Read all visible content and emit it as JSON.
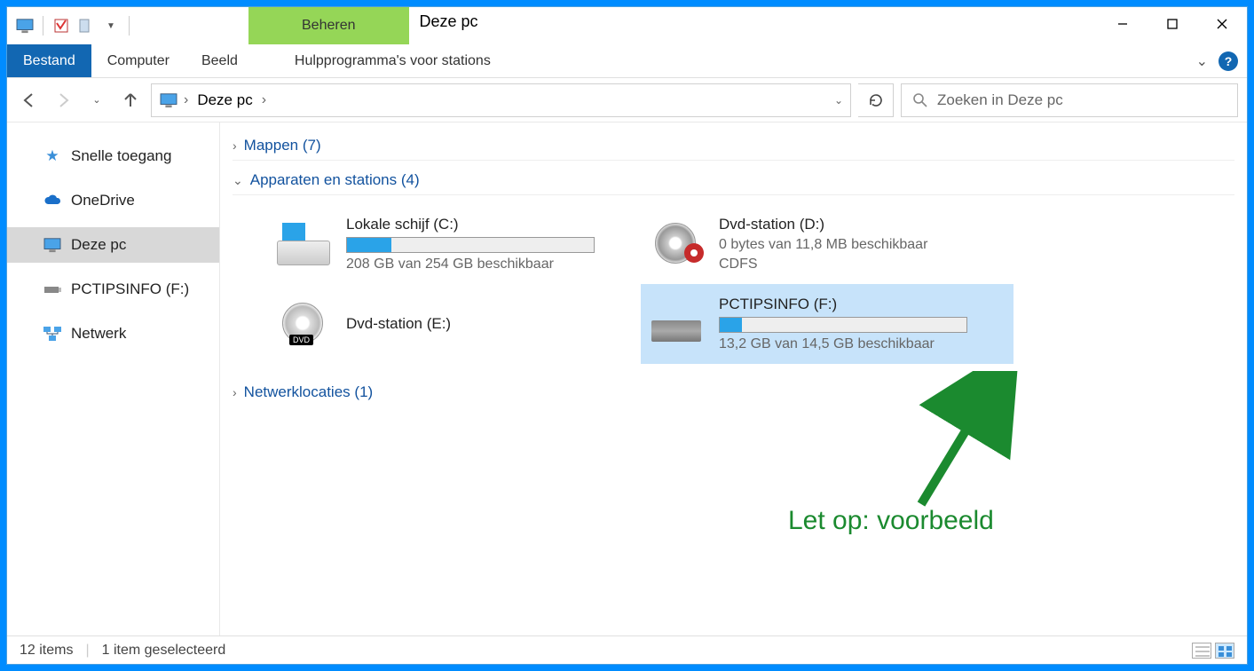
{
  "window": {
    "title": "Deze pc",
    "contextual_tab_label": "Beheren"
  },
  "ribbon": {
    "file_label": "Bestand",
    "tabs": [
      "Computer",
      "Beeld"
    ],
    "context_tab": "Hulpprogramma's voor stations"
  },
  "address": {
    "crumb": "Deze pc"
  },
  "search": {
    "placeholder": "Zoeken in Deze pc"
  },
  "sidebar": {
    "items": [
      {
        "label": "Snelle toegang",
        "icon": "star"
      },
      {
        "label": "OneDrive",
        "icon": "cloud"
      },
      {
        "label": "Deze pc",
        "icon": "pc",
        "selected": true
      },
      {
        "label": "PCTIPSINFO (F:)",
        "icon": "usb"
      },
      {
        "label": "Netwerk",
        "icon": "network"
      }
    ]
  },
  "groups": {
    "folders": {
      "label": "Mappen",
      "count": 7
    },
    "devices": {
      "label": "Apparaten en stations",
      "count": 4
    },
    "network": {
      "label": "Netwerklocaties",
      "count": 1
    }
  },
  "drives": [
    {
      "name": "Lokale schijf (C:)",
      "sub": "208 GB van 254 GB beschikbaar",
      "fill_pct": 18,
      "icon": "hdd-win",
      "has_bar": true
    },
    {
      "name": "Dvd-station (D:)",
      "sub": "0 bytes van 11,8 MB beschikbaar",
      "sub2": "CDFS",
      "icon": "dvd-gear",
      "has_bar": false
    },
    {
      "name": "Dvd-station (E:)",
      "sub": "",
      "icon": "dvd",
      "has_bar": false
    },
    {
      "name": "PCTIPSINFO (F:)",
      "sub": "13,2 GB van 14,5 GB beschikbaar",
      "fill_pct": 9,
      "icon": "usb",
      "has_bar": true,
      "selected": true
    }
  ],
  "annotation": {
    "text": "Let op: voorbeeld"
  },
  "statusbar": {
    "items_label": "12 items",
    "selection_label": "1 item geselecteerd"
  }
}
